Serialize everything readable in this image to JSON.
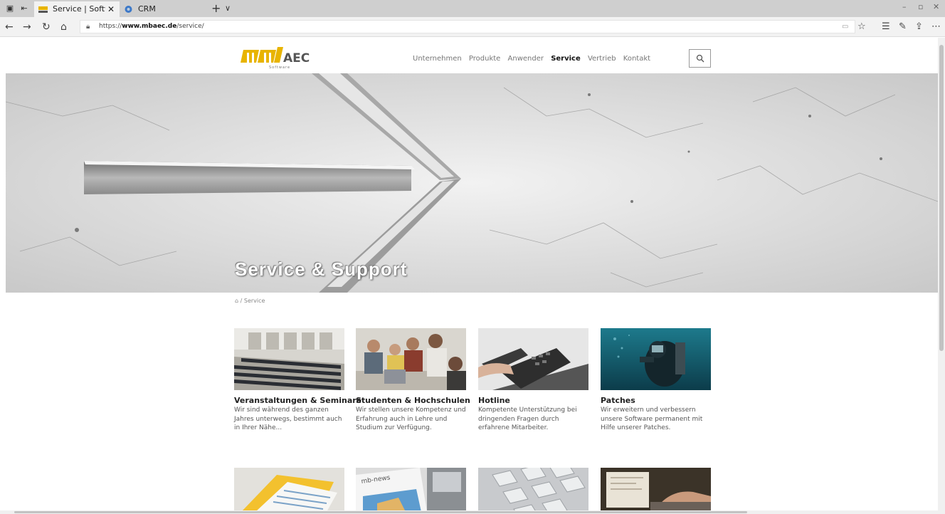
{
  "browser": {
    "tabs": [
      {
        "title": "Service | Software für Ar",
        "active": true
      },
      {
        "title": "CRM",
        "active": false
      }
    ],
    "new_tab": "+",
    "tab_menu": "∨",
    "url_prefix": "https://",
    "url_host": "www.mbaec.de",
    "url_path": "/service/",
    "window_controls": {
      "minimize": "–",
      "maximize": "▫",
      "close": "✕"
    }
  },
  "header": {
    "nav": [
      "Unternehmen",
      "Produkte",
      "Anwender",
      "Service",
      "Vertrieb",
      "Kontakt"
    ],
    "active_nav": "Service"
  },
  "hero": {
    "title": "Service & Support"
  },
  "breadcrumb": {
    "home_icon": "home-icon",
    "separator": "/",
    "current": "Service"
  },
  "cards": [
    {
      "title": "Veranstaltungen & Seminare",
      "description": "Wir sind während des ganzen Jahres unterwegs, bestimmt auch in Ihrer Nähe..."
    },
    {
      "title": "Studenten & Hochschulen",
      "description": "Wir stellen unsere Kompetenz und Erfahrung auch in Lehre und Studium zur Verfügung."
    },
    {
      "title": "Hotline",
      "description": "Kompetente Unterstützung bei dringenden Fragen durch erfahrene Mitarbeiter."
    },
    {
      "title": "Patches",
      "description": "Wir erweitern und verbessern unsere Software permanent mit Hilfe unserer Patches."
    }
  ],
  "second_row_thumb_text": "mb-news",
  "colors": {
    "logo_yellow": "#e8b400",
    "logo_grey": "#555555",
    "nav_active": "#111111"
  }
}
